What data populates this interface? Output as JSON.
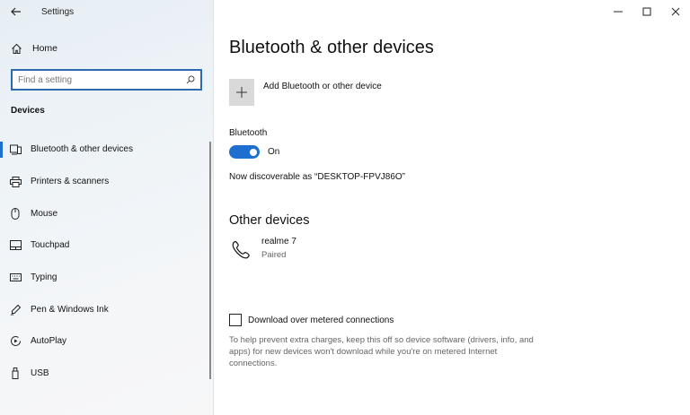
{
  "window": {
    "title": "Settings",
    "minimize_icon": "minimize-icon",
    "maximize_icon": "maximize-icon",
    "close_icon": "close-icon"
  },
  "sidebar": {
    "home_label": "Home",
    "search_placeholder": "Find a setting",
    "section_title": "Devices",
    "items": [
      {
        "label": "Bluetooth & other devices",
        "icon": "bluetooth-devices-icon",
        "active": true
      },
      {
        "label": "Printers & scanners",
        "icon": "printer-icon"
      },
      {
        "label": "Mouse",
        "icon": "mouse-icon"
      },
      {
        "label": "Touchpad",
        "icon": "touchpad-icon"
      },
      {
        "label": "Typing",
        "icon": "keyboard-icon"
      },
      {
        "label": "Pen & Windows Ink",
        "icon": "pen-icon"
      },
      {
        "label": "AutoPlay",
        "icon": "autoplay-icon"
      },
      {
        "label": "USB",
        "icon": "usb-icon"
      }
    ]
  },
  "main": {
    "page_title": "Bluetooth & other devices",
    "add_device_label": "Add Bluetooth or other device",
    "bluetooth_label": "Bluetooth",
    "bluetooth_state": "On",
    "discoverable_text": "Now discoverable as “DESKTOP-FPVJ86O”",
    "other_devices_title": "Other devices",
    "devices": [
      {
        "name": "realme 7",
        "status": "Paired",
        "icon": "phone-icon"
      }
    ],
    "metered_label": "Download over metered connections",
    "metered_checked": false,
    "metered_help": "To help prevent extra charges, keep this off so device software (drivers, info, and apps) for new devices won't download while you're on metered Internet connections."
  },
  "colors": {
    "accent": "#1f6fd0"
  }
}
